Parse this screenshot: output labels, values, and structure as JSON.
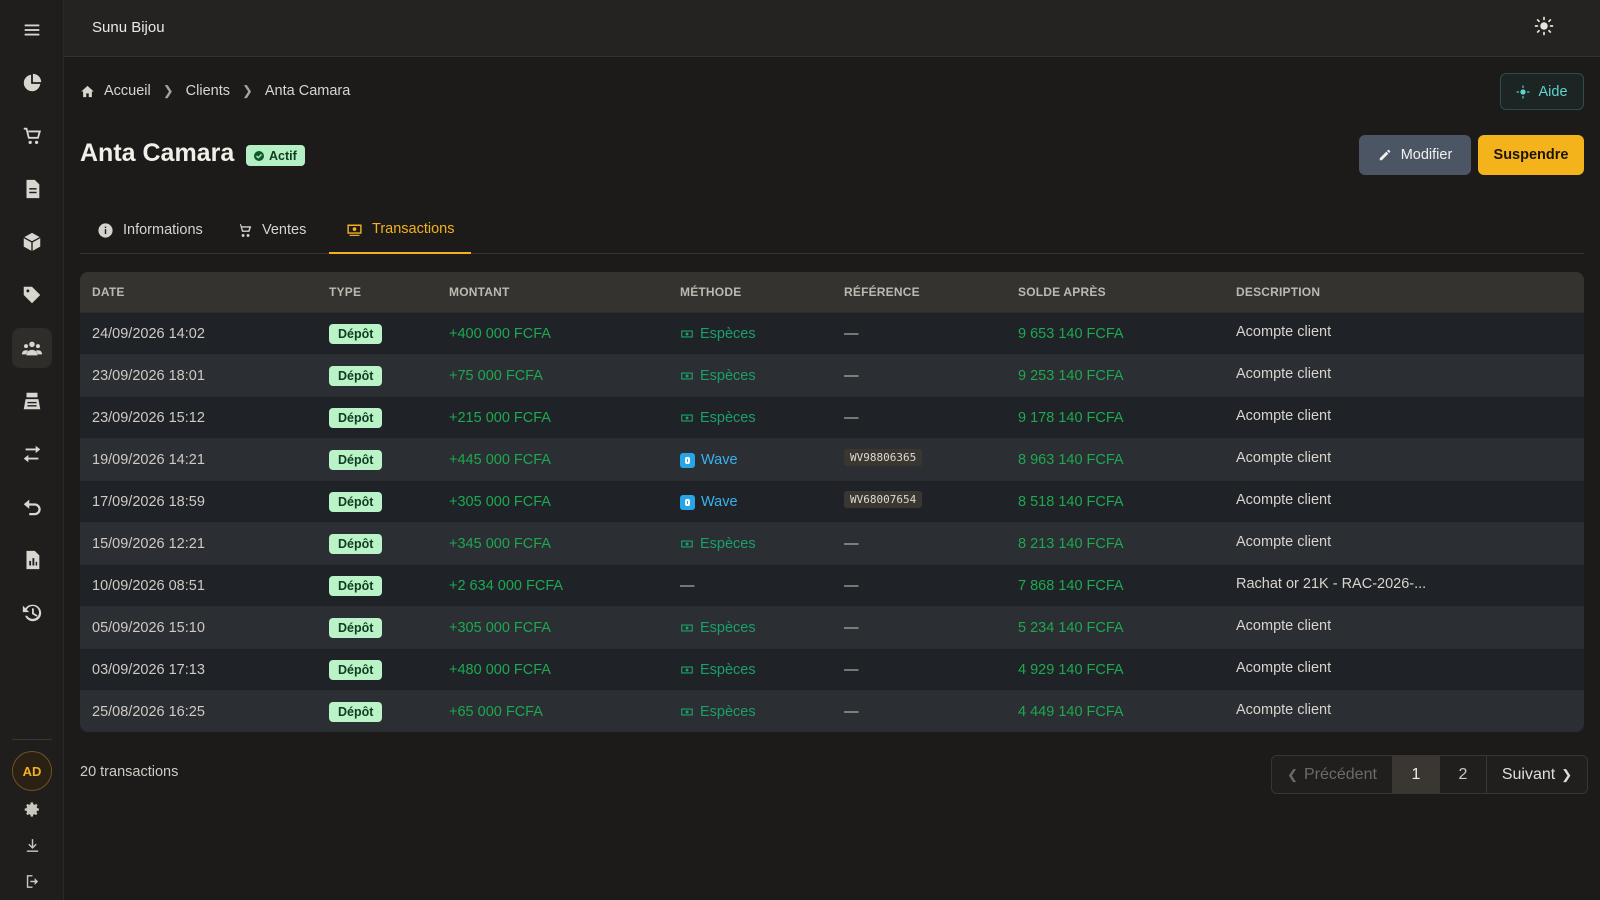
{
  "app": {
    "title": "Sunu Bijou"
  },
  "breadcrumb": {
    "home": "Accueil",
    "clients": "Clients",
    "current": "Anta Camara"
  },
  "header": {
    "help_label": "Aide",
    "client_name": "Anta Camara",
    "status": "Actif",
    "edit_label": "Modifier",
    "suspend_label": "Suspendre"
  },
  "tabs": [
    {
      "label": "Informations",
      "icon": "info-icon"
    },
    {
      "label": "Ventes",
      "icon": "cart-icon"
    },
    {
      "label": "Transactions",
      "icon": "money-icon",
      "active": true
    }
  ],
  "table": {
    "headers": [
      "DATE",
      "TYPE",
      "MONTANT",
      "MÉTHODE",
      "RÉFÉRENCE",
      "SOLDE APRÈS",
      "DESCRIPTION"
    ],
    "rows": [
      {
        "date": "24/09/2026 14:02",
        "type": "Dépôt",
        "amount": "+400 000 FCFA",
        "method": "Espèces",
        "method_kind": "cash",
        "ref": "—",
        "balance": "9 653 140 FCFA",
        "desc": "Acompte client"
      },
      {
        "date": "23/09/2026 18:01",
        "type": "Dépôt",
        "amount": "+75 000 FCFA",
        "method": "Espèces",
        "method_kind": "cash",
        "ref": "—",
        "balance": "9 253 140 FCFA",
        "desc": "Acompte client"
      },
      {
        "date": "23/09/2026 15:12",
        "type": "Dépôt",
        "amount": "+215 000 FCFA",
        "method": "Espèces",
        "method_kind": "cash",
        "ref": "—",
        "balance": "9 178 140 FCFA",
        "desc": "Acompte client"
      },
      {
        "date": "19/09/2026 14:21",
        "type": "Dépôt",
        "amount": "+445 000 FCFA",
        "method": "Wave",
        "method_kind": "wave",
        "ref": "WV98806365",
        "balance": "8 963 140 FCFA",
        "desc": "Acompte client"
      },
      {
        "date": "17/09/2026 18:59",
        "type": "Dépôt",
        "amount": "+305 000 FCFA",
        "method": "Wave",
        "method_kind": "wave",
        "ref": "WV68007654",
        "balance": "8 518 140 FCFA",
        "desc": "Acompte client"
      },
      {
        "date": "15/09/2026 12:21",
        "type": "Dépôt",
        "amount": "+345 000 FCFA",
        "method": "Espèces",
        "method_kind": "cash",
        "ref": "—",
        "balance": "8 213 140 FCFA",
        "desc": "Acompte client"
      },
      {
        "date": "10/09/2026 08:51",
        "type": "Dépôt",
        "amount": "+2 634 000 FCFA",
        "method": "—",
        "method_kind": "none",
        "ref": "—",
        "balance": "7 868 140 FCFA",
        "desc": "Rachat or 21K - RAC-2026-..."
      },
      {
        "date": "05/09/2026 15:10",
        "type": "Dépôt",
        "amount": "+305 000 FCFA",
        "method": "Espèces",
        "method_kind": "cash",
        "ref": "—",
        "balance": "5 234 140 FCFA",
        "desc": "Acompte client"
      },
      {
        "date": "03/09/2026 17:13",
        "type": "Dépôt",
        "amount": "+480 000 FCFA",
        "method": "Espèces",
        "method_kind": "cash",
        "ref": "—",
        "balance": "4 929 140 FCFA",
        "desc": "Acompte client"
      },
      {
        "date": "25/08/2026 16:25",
        "type": "Dépôt",
        "amount": "+65 000 FCFA",
        "method": "Espèces",
        "method_kind": "cash",
        "ref": "—",
        "balance": "4 449 140 FCFA",
        "desc": "Acompte client"
      }
    ]
  },
  "footer": {
    "count": "20 transactions",
    "prev": "Précédent",
    "page1": "1",
    "page2": "2",
    "next": "Suivant"
  },
  "user": {
    "initials": "AD"
  },
  "colors": {
    "accent": "#f2b21d",
    "positive": "#1ea84f",
    "wave": "#26a6e8",
    "teal": "#5fd4cf"
  }
}
